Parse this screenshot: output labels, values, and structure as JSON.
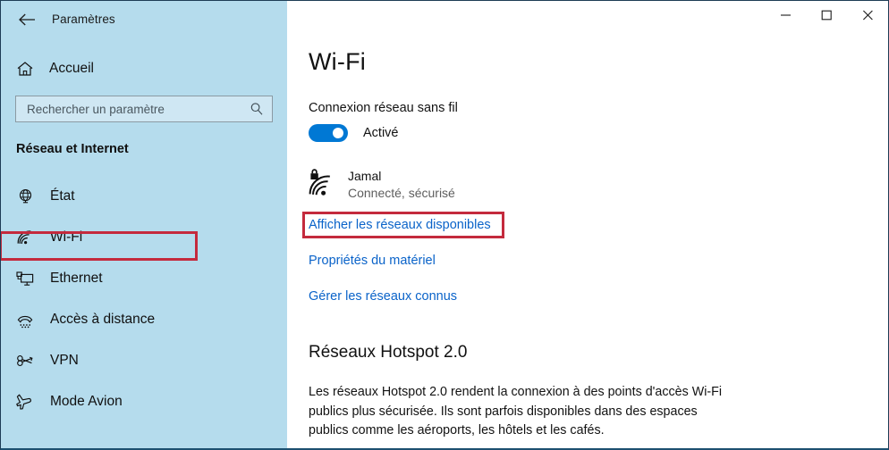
{
  "window": {
    "app_title": "Paramètres",
    "back_icon": "back-arrow-icon",
    "controls": {
      "minimize_label": "─",
      "maximize_label": "□",
      "close_label": "✕"
    }
  },
  "sidebar": {
    "home": {
      "label": "Accueil",
      "icon": "home-icon"
    },
    "search": {
      "placeholder": "Rechercher un paramètre",
      "value": "",
      "icon": "search-icon"
    },
    "group_title": "Réseau et Internet",
    "items": [
      {
        "label": "État",
        "icon": "globe-monitor-icon",
        "selected": false
      },
      {
        "label": "Wi-Fi",
        "icon": "wifi-icon",
        "selected": true
      },
      {
        "label": "Ethernet",
        "icon": "ethernet-icon",
        "selected": false
      },
      {
        "label": "Accès à distance",
        "icon": "phone-dialup-icon",
        "selected": false
      },
      {
        "label": "VPN",
        "icon": "vpn-key-icon",
        "selected": false
      },
      {
        "label": "Mode Avion",
        "icon": "airplane-icon",
        "selected": false
      }
    ]
  },
  "main": {
    "page_title": "Wi-Fi",
    "connection_label": "Connexion réseau sans fil",
    "toggle": {
      "state_label": "Activé",
      "on": true,
      "color": "#0078d4"
    },
    "network": {
      "name": "Jamal",
      "status": "Connecté, sécurisé",
      "icon": "wifi-secured-icon"
    },
    "links": [
      "Afficher les réseaux disponibles",
      "Propriétés du matériel",
      "Gérer les réseaux connus"
    ],
    "section": {
      "title": "Réseaux Hotspot 2.0",
      "body": "Les réseaux Hotspot 2.0 rendent la connexion à des points d'accès Wi-Fi publics plus sécurisée. Ils sont parfois disponibles dans des espaces publics comme les aéroports, les hôtels et les cafés."
    }
  },
  "annotations": {
    "highlight_color": "#c42a3d",
    "boxes": [
      {
        "target": "sidebar-item-wi-fi"
      },
      {
        "target": "link-afficher-les-reseaux-disponibles"
      }
    ]
  }
}
